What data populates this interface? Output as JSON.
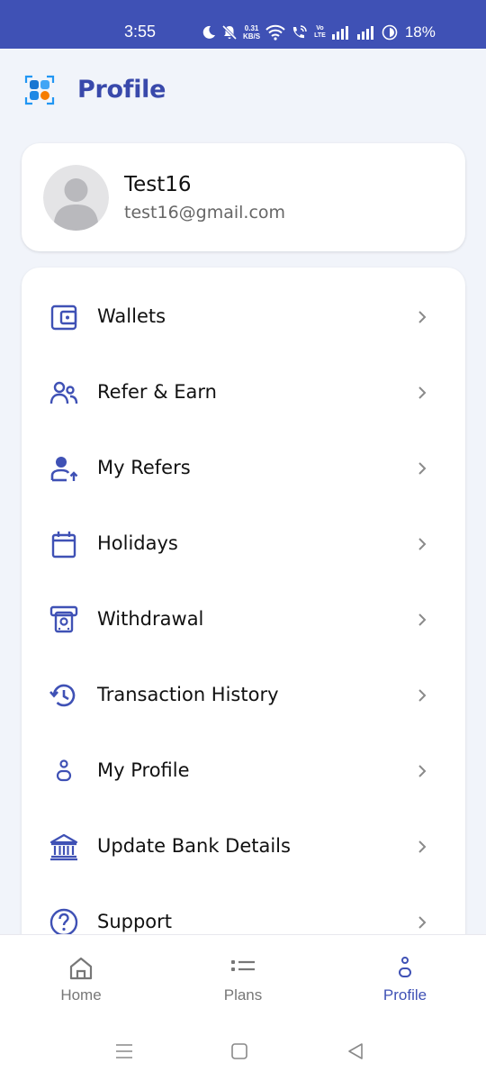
{
  "status_bar": {
    "time": "3:55",
    "net_speed_value": "0.31",
    "net_speed_unit": "KB/S",
    "volte_top": "Vo",
    "volte_bottom": "LTE",
    "battery": "18%"
  },
  "header": {
    "title": "Profile",
    "logo_icon": "app-grid-logo-icon"
  },
  "profile": {
    "name": "Test16",
    "email": "test16@gmail.com"
  },
  "menu": {
    "items": [
      {
        "label": "Wallets",
        "icon": "wallet-icon"
      },
      {
        "label": "Refer & Earn",
        "icon": "users-icon"
      },
      {
        "label": "My Refers",
        "icon": "user-upload-icon"
      },
      {
        "label": "Holidays",
        "icon": "calendar-icon"
      },
      {
        "label": "Withdrawal",
        "icon": "atm-cash-icon"
      },
      {
        "label": "Transaction History",
        "icon": "history-icon"
      },
      {
        "label": "My Profile",
        "icon": "person-icon"
      },
      {
        "label": "Update Bank Details",
        "icon": "bank-icon"
      },
      {
        "label": "Support",
        "icon": "help-circle-icon"
      }
    ]
  },
  "bottom_nav": {
    "items": [
      {
        "label": "Home",
        "icon": "home-icon",
        "active": false
      },
      {
        "label": "Plans",
        "icon": "list-icon",
        "active": false
      },
      {
        "label": "Profile",
        "icon": "person-icon",
        "active": true
      }
    ]
  },
  "colors": {
    "accent": "#3f51b5",
    "title": "#3949ab",
    "background": "#f1f4fa",
    "card": "#ffffff"
  }
}
